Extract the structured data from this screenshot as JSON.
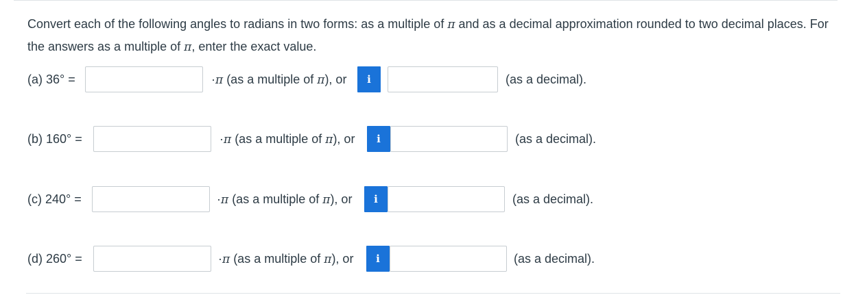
{
  "instructions": {
    "part1": "Convert each of the following angles to radians in two forms: as a multiple of ",
    "pi1": "π",
    "part2": " and as a decimal approximation rounded to two decimal places. For the answers as a multiple of ",
    "pi2": "π",
    "part3": ", enter the exact value."
  },
  "rows": [
    {
      "label": "(a) 36° =",
      "multiple_value": "",
      "mult_prefix": "·",
      "mult_pi": "π",
      "mult_text": " (as a multiple of ",
      "mult_pi2": "π",
      "mult_close": "), or",
      "info_icon": "i",
      "decimal_value": "",
      "suffix": "(as a decimal)."
    },
    {
      "label": "(b) 160° =",
      "multiple_value": "",
      "mult_prefix": "·",
      "mult_pi": "π",
      "mult_text": " (as a multiple of ",
      "mult_pi2": "π",
      "mult_close": "), or",
      "info_icon": "i",
      "decimal_value": "",
      "suffix": "(as a decimal)."
    },
    {
      "label": "(c) 240° =",
      "multiple_value": "",
      "mult_prefix": "·",
      "mult_pi": "π",
      "mult_text": " (as a multiple of ",
      "mult_pi2": "π",
      "mult_close": "), or",
      "info_icon": "i",
      "decimal_value": "",
      "suffix": "(as a decimal)."
    },
    {
      "label": "(d) 260° =",
      "multiple_value": "",
      "mult_prefix": "·",
      "mult_pi": "π",
      "mult_text": " (as a multiple of ",
      "mult_pi2": "π",
      "mult_close": "), or",
      "info_icon": "i",
      "decimal_value": "",
      "suffix": "(as a decimal)."
    }
  ],
  "colors": {
    "info_button": "#1a73d9",
    "text": "#2d3b45",
    "input_border": "#c7cdd1"
  },
  "icons": {
    "info": "info-icon"
  }
}
